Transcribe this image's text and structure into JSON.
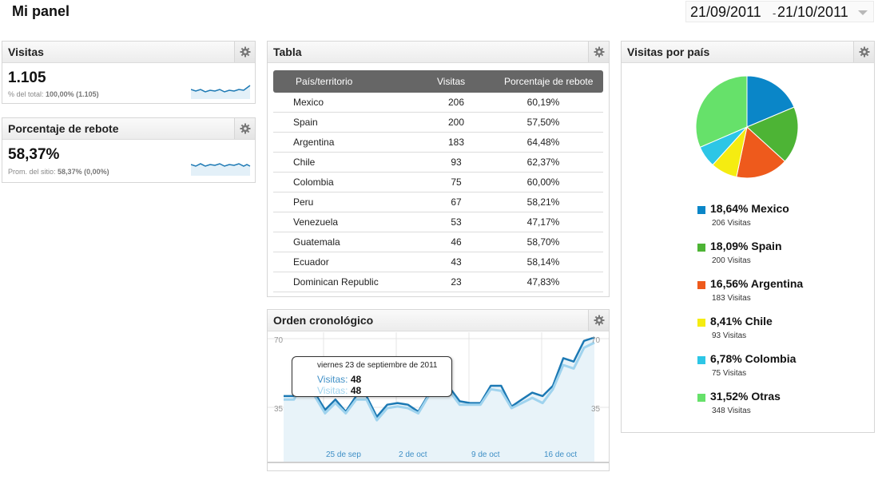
{
  "header": {
    "title": "Mi panel",
    "date_start": "21/09/2011",
    "date_sep": "-",
    "date_end": "21/10/2011"
  },
  "colors": {
    "line_dark": "#1c79b4",
    "line_light": "#9fd3ee",
    "area_fill": "#e8f3f9",
    "pie": [
      "#0a86c8",
      "#4db435",
      "#ee5a1c",
      "#f5ec11",
      "#2dc6e6",
      "#66e16a"
    ]
  },
  "visits_widget": {
    "title": "Visitas",
    "value": "1.105",
    "sub_label": "% del total:",
    "sub_value": "100,00% (1.105)"
  },
  "bounce_widget": {
    "title": "Porcentaje de rebote",
    "value": "58,37%",
    "sub_label": "Prom. del sitio:",
    "sub_value": "58,37% (0,00%)"
  },
  "table_widget": {
    "title": "Tabla",
    "headers": [
      "País/territorio",
      "Visitas",
      "Porcentaje de rebote"
    ],
    "rows": [
      [
        "Mexico",
        "206",
        "60,19%"
      ],
      [
        "Spain",
        "200",
        "57,50%"
      ],
      [
        "Argentina",
        "183",
        "64,48%"
      ],
      [
        "Chile",
        "93",
        "62,37%"
      ],
      [
        "Colombia",
        "75",
        "60,00%"
      ],
      [
        "Peru",
        "67",
        "58,21%"
      ],
      [
        "Venezuela",
        "53",
        "47,17%"
      ],
      [
        "Guatemala",
        "46",
        "58,70%"
      ],
      [
        "Ecuador",
        "43",
        "58,14%"
      ],
      [
        "Dominican Republic",
        "23",
        "47,83%"
      ]
    ]
  },
  "timeline_widget": {
    "title": "Orden cronológico",
    "tooltip": {
      "date": "viernes 23 de septiembre de 2011",
      "label": "Visitas:",
      "value1": "48",
      "value2": "48"
    }
  },
  "pie_widget": {
    "title": "Visitas por país",
    "legend": [
      {
        "pct": "18,64%",
        "name": "Mexico",
        "count": "206 Visitas"
      },
      {
        "pct": "18,09%",
        "name": "Spain",
        "count": "200 Visitas"
      },
      {
        "pct": "16,56%",
        "name": "Argentina",
        "count": "183 Visitas"
      },
      {
        "pct": "8,41%",
        "name": "Chile",
        "count": "93 Visitas"
      },
      {
        "pct": "6,78%",
        "name": "Colombia",
        "count": "75 Visitas"
      },
      {
        "pct": "31,52%",
        "name": "Otras",
        "count": "348 Visitas"
      }
    ]
  },
  "chart_data": [
    {
      "type": "pie",
      "title": "Visitas por país",
      "categories": [
        "Mexico",
        "Spain",
        "Argentina",
        "Chile",
        "Colombia",
        "Otras"
      ],
      "values": [
        206,
        200,
        183,
        93,
        75,
        348
      ],
      "percent_labels": [
        "18,64%",
        "18,09%",
        "16,56%",
        "8,41%",
        "6,78%",
        "31,52%"
      ],
      "legend": "right-below"
    },
    {
      "type": "line",
      "title": "Orden cronológico",
      "x": [
        "21/09",
        "22/09",
        "23/09",
        "24/09",
        "25/09",
        "26/09",
        "27/09",
        "28/09",
        "29/09",
        "30/09",
        "01/10",
        "02/10",
        "03/10",
        "04/10",
        "05/10",
        "06/10",
        "07/10",
        "08/10",
        "09/10",
        "10/10",
        "11/10",
        "12/10",
        "13/10",
        "14/10",
        "15/10",
        "16/10",
        "17/10",
        "18/10",
        "19/10",
        "20/10",
        "21/10"
      ],
      "x_tick_labels": [
        "25 de sep",
        "2 de oct",
        "9 de oct",
        "16 de oct"
      ],
      "series": [
        {
          "values": [
            38,
            38,
            48,
            40,
            30,
            36,
            29,
            38,
            38,
            26,
            33,
            34,
            33,
            29,
            39,
            49,
            43,
            35,
            34,
            34,
            44,
            44,
            32,
            36,
            40,
            38,
            44,
            60,
            58,
            70,
            72
          ]
        },
        {
          "values": [
            36,
            36,
            48,
            38,
            28,
            34,
            28,
            36,
            36,
            24,
            31,
            32,
            31,
            28,
            38,
            47,
            41,
            33,
            33,
            33,
            42,
            41,
            31,
            34,
            37,
            34,
            42,
            56,
            54,
            66,
            69
          ]
        }
      ],
      "y_tick_labels": [
        "70",
        "35"
      ],
      "ylim": [
        0,
        75
      ],
      "grid": true
    }
  ]
}
